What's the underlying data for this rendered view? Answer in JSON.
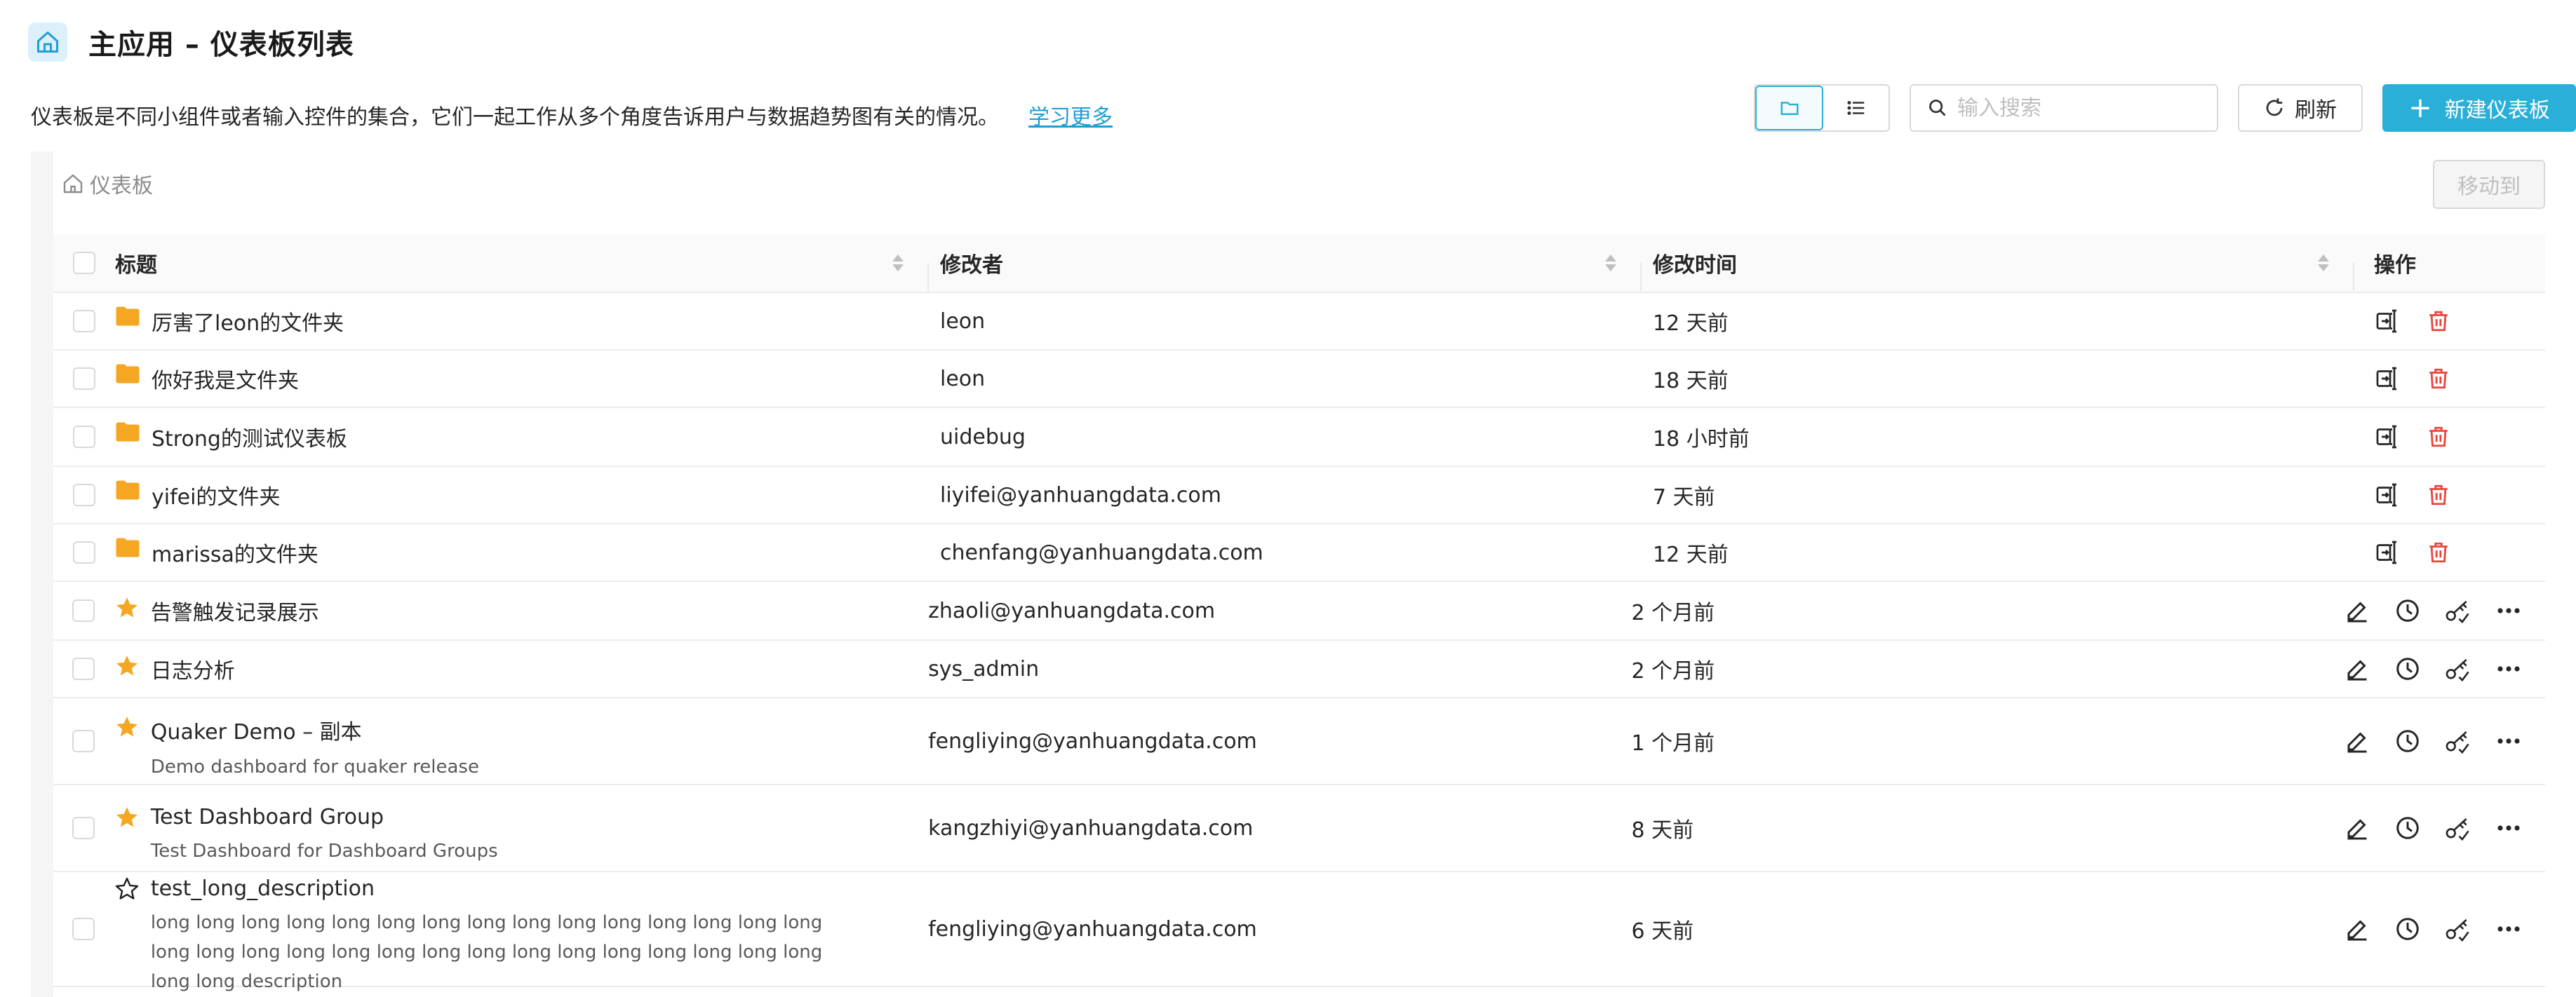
{
  "header": {
    "title": "主应用 – 仪表板列表",
    "description": "仪表板是不同小组件或者输入控件的集合，它们一起工作从多个角度告诉用户与数据趋势图有关的情况。",
    "learn_more": "学习更多"
  },
  "toolbar": {
    "search_placeholder": "输入搜索",
    "refresh_label": "刷新",
    "new_label": "新建仪表板",
    "move_label": "移动到"
  },
  "breadcrumb": {
    "label": "仪表板"
  },
  "table": {
    "columns": {
      "title": "标题",
      "modifier": "修改者",
      "time": "修改时间",
      "actions": "操作"
    },
    "rows": [
      {
        "type": "folder",
        "title": "厉害了leon的文件夹",
        "description": "",
        "modifier": "leon",
        "time": "12 天前"
      },
      {
        "type": "folder",
        "title": "你好我是文件夹",
        "description": "",
        "modifier": "leon",
        "time": "18 天前"
      },
      {
        "type": "folder",
        "title": "Strong的测试仪表板",
        "description": "",
        "modifier": "uidebug",
        "time": "18 小时前"
      },
      {
        "type": "folder",
        "title": "yifei的文件夹",
        "description": "",
        "modifier": "liyifei@yanhuangdata.com",
        "time": "7 天前"
      },
      {
        "type": "folder",
        "title": "marissa的文件夹",
        "description": "",
        "modifier": "chenfang@yanhuangdata.com",
        "time": "12 天前"
      },
      {
        "type": "dashboard",
        "starred": true,
        "title": "告警触发记录展示",
        "description": "",
        "modifier": "zhaoli@yanhuangdata.com",
        "time": "2 个月前"
      },
      {
        "type": "dashboard",
        "starred": true,
        "title": "日志分析",
        "description": "",
        "modifier": "sys_admin",
        "time": "2 个月前"
      },
      {
        "type": "dashboard",
        "starred": true,
        "title": "Quaker Demo – 副本",
        "description": "Demo dashboard for quaker release",
        "modifier": "fengliying@yanhuangdata.com",
        "time": "1 个月前"
      },
      {
        "type": "dashboard",
        "starred": true,
        "title": "Test Dashboard Group",
        "description": "Test Dashboard for Dashboard Groups",
        "modifier": "kangzhiyi@yanhuangdata.com",
        "time": "8 天前"
      },
      {
        "type": "dashboard",
        "starred": false,
        "title": "test_long_description",
        "description": "long long long long long long long long long long long long long long long long long long long long long long long long long long long long long long long long description",
        "modifier": "fengliying@yanhuangdata.com",
        "time": "6 天前"
      }
    ]
  },
  "colors": {
    "accent": "#2ab0d8",
    "folder": "#f5a623",
    "star": "#f5a623",
    "delete": "#e8453c",
    "link": "#1f9ed6"
  },
  "icons": [
    "home-icon",
    "folder-view-icon",
    "list-view-icon",
    "search-icon",
    "refresh-icon",
    "plus-icon",
    "folder-icon",
    "star-icon",
    "move-icon",
    "delete-icon",
    "edit-icon",
    "clock-icon",
    "share-icon",
    "more-icon"
  ]
}
